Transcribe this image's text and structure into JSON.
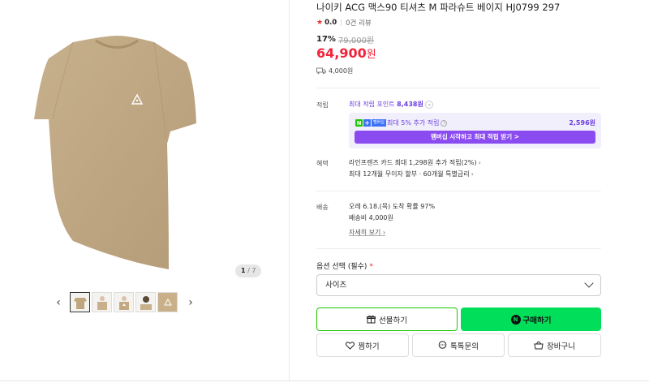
{
  "gallery": {
    "counter_current": "1",
    "counter_total": "/ 7",
    "thumb_count": 5
  },
  "product": {
    "title": "나이키 ACG 맥스90 티셔츠 M 파라슈트 베이지 HJ0799 297",
    "rating": "0.0",
    "reviews": "0건 리뷰",
    "discount_rate": "17%",
    "original_price": "79,000원",
    "price_value": "64,900",
    "price_unit": "원",
    "shipping_fee": "4,000원"
  },
  "points": {
    "label": "적립",
    "link_prefix": "최대 적립 포인트",
    "link_amount": "8,438원",
    "badge_text": "멤버십",
    "membership_text": "최대 5% 추가 적립",
    "membership_amount": "2,596원",
    "membership_button": "멤버십 시작하고 최대 적립 받기 >"
  },
  "benefits": {
    "label": "혜택",
    "line1": "라인프렌즈 카드 최대 1,298원 추가 적립(2%)",
    "line2": "최대 12개월 무이자 할부 · 60개월 특별금리"
  },
  "delivery": {
    "label": "배송",
    "line1": "오레 6.18.(목) 도착 확률 97%",
    "line2": "배송비 4,000원",
    "detail_link": "자세히 보기"
  },
  "options": {
    "label": "옵션 선택 (필수)",
    "required_mark": "*",
    "select_value": "사이즈"
  },
  "actions": {
    "gift": "선물하기",
    "buy": "구매하기",
    "wish": "찜하기",
    "talk": "톡톡문의",
    "cart": "장바구니"
  },
  "colors": {
    "price_red": "#f0243b",
    "naver_green": "#00de5a",
    "membership_purple": "#8a4cf0"
  }
}
